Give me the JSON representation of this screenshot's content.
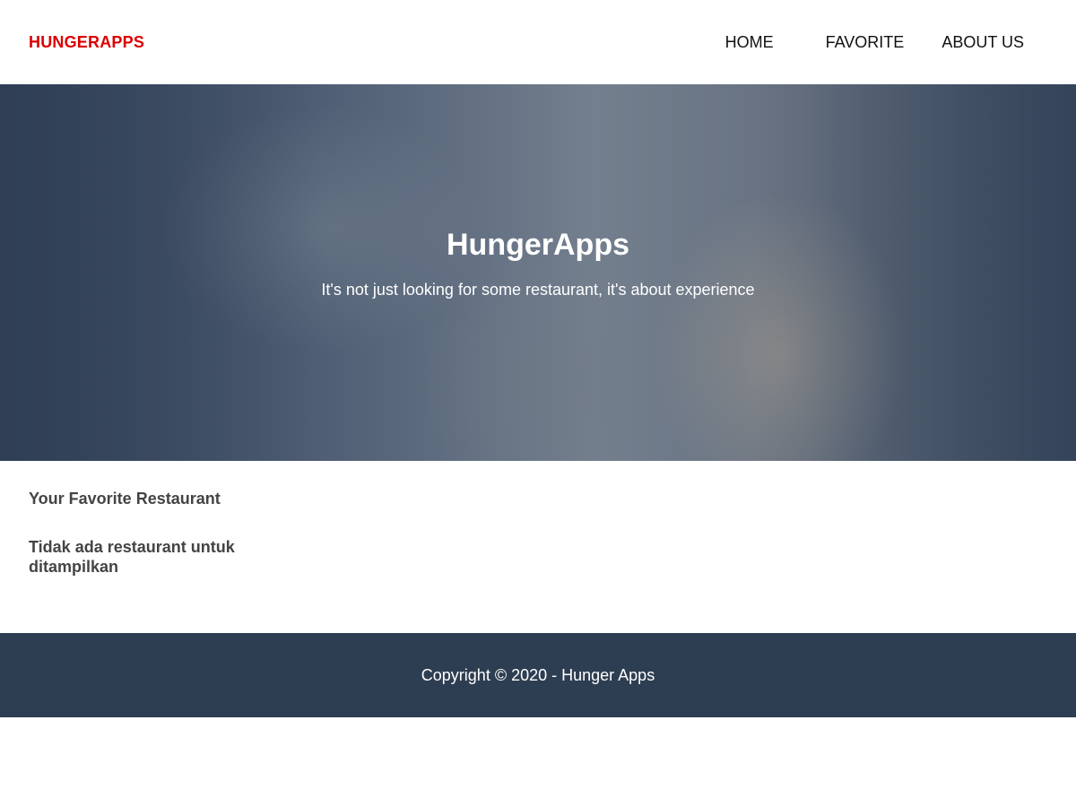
{
  "header": {
    "brand": "HUNGERAPPS",
    "nav": {
      "home": "HOME",
      "favorite": "FAVORITE",
      "about": "ABOUT US"
    }
  },
  "hero": {
    "title": "HungerApps",
    "tagline": "It's not just looking for some restaurant, it's about experience"
  },
  "main": {
    "section_title": "Your Favorite Restaurant",
    "empty_message": "Tidak ada restaurant untuk ditampilkan"
  },
  "footer": {
    "copyright": "Copyright © 2020 - Hunger Apps"
  },
  "colors": {
    "brand": "#db0000",
    "footer_bg": "#2e3e52"
  }
}
